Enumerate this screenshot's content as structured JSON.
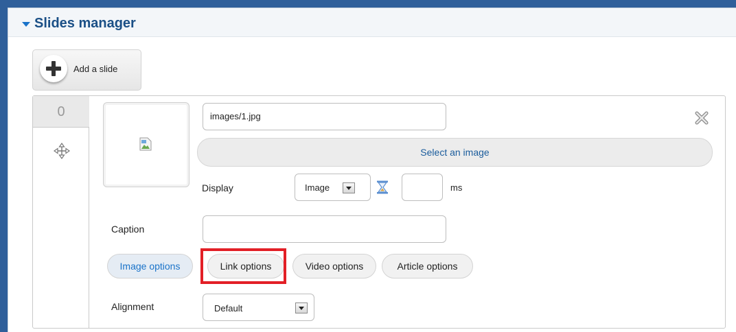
{
  "panel": {
    "title": "Slides manager",
    "add_slide_label": "Add a slide"
  },
  "slide": {
    "number": "0",
    "image_path": "images/1.jpg",
    "select_image_label": "Select an image",
    "display_label": "Display",
    "display_value": "Image",
    "duration_value": "",
    "ms_label": "ms",
    "caption_label": "Caption",
    "caption_value": "",
    "tabs": [
      {
        "label": "Image options",
        "active": true
      },
      {
        "label": "Link options",
        "active": false
      },
      {
        "label": "Video options",
        "active": false
      },
      {
        "label": "Article options",
        "active": false
      }
    ],
    "alignment_label": "Alignment",
    "alignment_value": "Default"
  },
  "icons": {
    "collapse": "triangle-down-icon",
    "add": "plus-icon",
    "move": "move-icon",
    "close": "close-icon",
    "broken_image": "broken-image-icon",
    "hourglass": "hourglass-icon",
    "dropdown": "chevron-down-icon"
  },
  "colors": {
    "background": "#2f5f9a",
    "title": "#1a4f86",
    "accent": "#1a73c9",
    "highlight": "#e21f26"
  }
}
